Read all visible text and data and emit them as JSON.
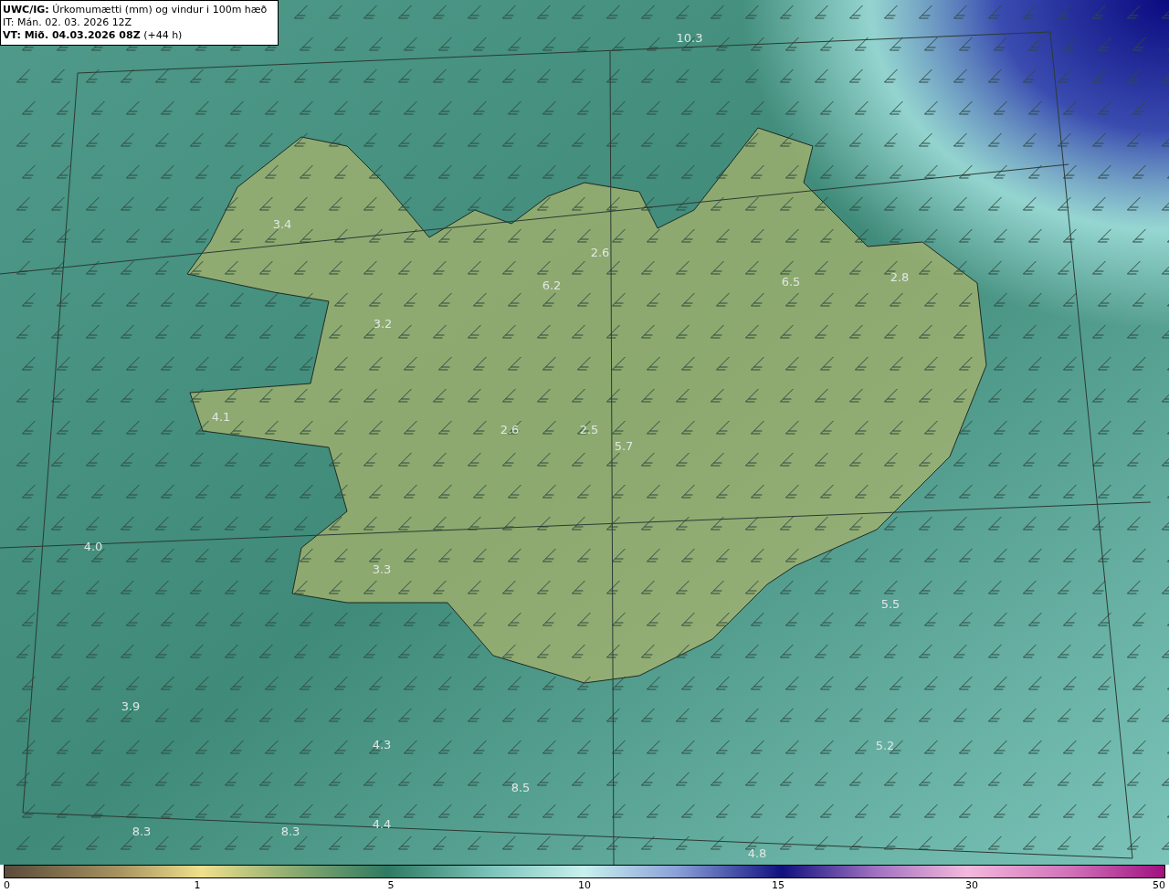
{
  "title_box": {
    "lines": [
      "**UWC/IG:** Úrkomumætti (mm) og vindur i 100m hæð",
      "IT: Mán. 02. 03. 2026 12Z",
      "**VT: Mið. 04.03.2026 08Z** (+44 h)"
    ]
  },
  "map": {
    "value_labels": [
      "10.3",
      "3.4",
      "6.2",
      "2.6",
      "6.5",
      "2.8",
      "3.2",
      "4.1",
      "2.6",
      "2.5",
      "5.7",
      "4.0",
      "3.3",
      "5.5",
      "3.9",
      "4.3",
      "5.2",
      "8.5",
      "8.3",
      "8.3",
      "4.4",
      "4.8"
    ]
  },
  "colorbar": {
    "ticks": [
      "0",
      "1",
      "5",
      "10",
      "15",
      "30",
      "50"
    ]
  }
}
